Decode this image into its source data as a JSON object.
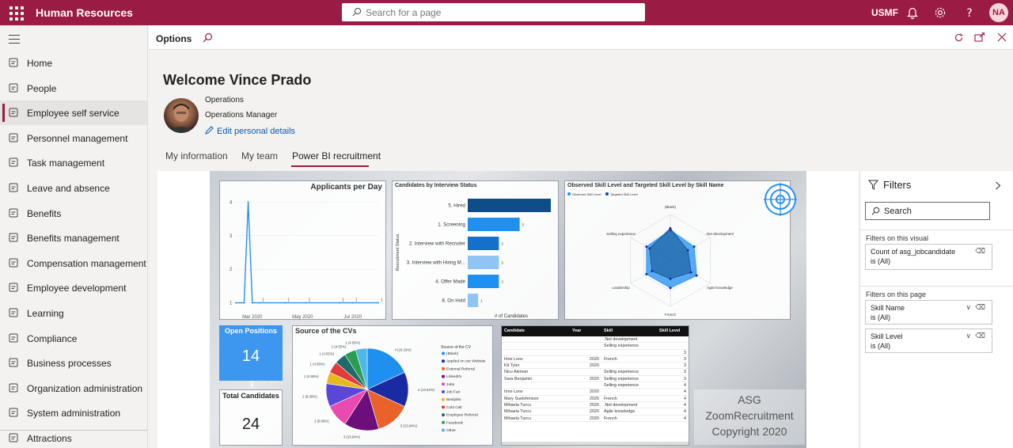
{
  "topbar": {
    "app_title": "Human Resources",
    "search_placeholder": "Search for a page",
    "company": "USMF",
    "user_initials": "NA"
  },
  "nav": {
    "items": [
      {
        "label": "Home",
        "icon": "home-icon"
      },
      {
        "label": "People",
        "icon": "people-icon"
      },
      {
        "label": "Employee self service",
        "icon": "self-service-icon",
        "active": true
      },
      {
        "label": "Personnel management",
        "icon": "personnel-icon"
      },
      {
        "label": "Task management",
        "icon": "task-icon"
      },
      {
        "label": "Leave and absence",
        "icon": "leave-icon"
      },
      {
        "label": "Benefits",
        "icon": "benefits-icon"
      },
      {
        "label": "Benefits management",
        "icon": "benefits-mgmt-icon"
      },
      {
        "label": "Compensation management",
        "icon": "compensation-icon"
      },
      {
        "label": "Employee development",
        "icon": "development-icon"
      },
      {
        "label": "Learning",
        "icon": "learning-icon"
      },
      {
        "label": "Compliance",
        "icon": "compliance-icon"
      },
      {
        "label": "Business processes",
        "icon": "process-icon"
      },
      {
        "label": "Organization administration",
        "icon": "org-icon"
      },
      {
        "label": "System administration",
        "icon": "system-icon"
      },
      {
        "label": "Attractions",
        "icon": "attractions-icon"
      }
    ]
  },
  "options_bar": {
    "label": "Options"
  },
  "profile": {
    "welcome": "Welcome Vince Prado",
    "department": "Operations",
    "title": "Operations Manager",
    "edit_link": "Edit personal details"
  },
  "tabs": [
    {
      "label": "My information"
    },
    {
      "label": "My team"
    },
    {
      "label": "Power BI recruitment",
      "active": true
    }
  ],
  "report": {
    "applicants": {
      "title": "Applicants per Day",
      "y_ticks": [
        "4",
        "3",
        "2",
        "1"
      ],
      "x_ticks": [
        "Mar 2020",
        "May 2020",
        "Jul 2020"
      ],
      "point_labels": [
        "1",
        "1",
        "1",
        "1",
        "1",
        "1"
      ]
    },
    "interview": {
      "title": "Candidates by Interview Status",
      "ylabel": "Recruitment Status",
      "xlabel": "# of Candidates"
    },
    "skill_radar": {
      "title": "Observed Skill Level and Targeted Skill Level by Skill Name",
      "legend": [
        "Observed Skill Level",
        "Targeted Skill Level"
      ],
      "axes": [
        "(Blank)",
        ".Net development",
        "Agile knowledge",
        "French",
        "Leadership",
        "Selling experience"
      ]
    },
    "open_positions": {
      "label": "Open Positions",
      "value": "14"
    },
    "total_candidates": {
      "label": "Total Candidates",
      "value": "24"
    },
    "source_cvs": {
      "title": "Source of the CVs",
      "legend_title": "Source of the CV",
      "legend": [
        "(Blank)",
        "Applied on our Website",
        "External Referral",
        "LinkedIN",
        "Jobs",
        "Job Fair",
        "Bestjobs",
        "Cold Call",
        "Employee Referral",
        "Facebook",
        "Other"
      ],
      "labels": [
        "4 (16.16%)",
        "3 (13.64%)",
        "3 (13.64%)",
        "3 (13.64%)",
        "2 (9.09%)",
        "2 (9.09%)",
        "1 (4.55%)",
        "1 (4.55%)",
        "1 (4.55%)",
        "1 (4.55%)",
        "1 (4.55%)"
      ]
    },
    "table": {
      "headers": [
        "Candidate",
        "Year",
        "Skill",
        "Skill Level"
      ],
      "rows": [
        [
          "",
          "",
          ".Net development",
          ""
        ],
        [
          "",
          "",
          "Selling experience",
          ""
        ],
        [
          "",
          "",
          "",
          "3"
        ],
        [
          "Irine Loox",
          "2020",
          "French",
          "3"
        ],
        [
          "Kit Tyler",
          "2020",
          "",
          "3"
        ],
        [
          "Nicu Aleman",
          "",
          "Selling experience",
          "3"
        ],
        [
          "Sara Benjamin",
          "2020",
          "Selling experience",
          "3"
        ],
        [
          "",
          "",
          "Selling experience",
          "4"
        ],
        [
          "Irine Loox",
          "2020",
          "",
          "4"
        ],
        [
          "Mary Suelohmson",
          "2020",
          "French",
          "4"
        ],
        [
          "Mihaela Turcu",
          "2020",
          ".Net development",
          "4"
        ],
        [
          "Mihaela Turcu",
          "2020",
          "Agile knowledge",
          "4"
        ],
        [
          "Mihaela Turcu",
          "2020",
          "French",
          "4"
        ]
      ]
    },
    "watermark": [
      "ASG",
      "ZoomRecruitment",
      "Copyright 2020"
    ]
  },
  "chart_data": [
    {
      "type": "line",
      "title": "Applicants per Day",
      "x": [
        "2020-02-10",
        "2020-02-20",
        "2020-02-25",
        "2020-03-01",
        "2020-03-10",
        "2020-04-10",
        "2020-05-05",
        "2020-06-15",
        "2020-07-01",
        "2020-08-01"
      ],
      "values": [
        1,
        1,
        4,
        1,
        1,
        1,
        1,
        1,
        1,
        1
      ],
      "ylim": [
        0.8,
        4.2
      ]
    },
    {
      "type": "bar",
      "orientation": "horizontal",
      "title": "Candidates by Interview Status",
      "categories": [
        "5. Hired",
        "1. Screening",
        "2. Interview with Recruiter",
        "3. Interview with Hiring M...",
        "4. Offer Made",
        "8. On Hold"
      ],
      "values": [
        8,
        5,
        3,
        3,
        3,
        1
      ],
      "colors": [
        "#0f4c8a",
        "#1f8ff0",
        "#1570cc",
        "#8fc4f5",
        "#1f8ff0",
        "#8fc4f5"
      ],
      "xlabel": "# of Candidates",
      "ylabel": "Recruitment Status"
    },
    {
      "type": "radar",
      "title": "Observed Skill Level and Targeted Skill Level by Skill Name",
      "axes": [
        "(Blank)",
        ".Net development",
        "Agile knowledge",
        "French",
        "Leadership",
        "Selling experience"
      ],
      "series": [
        {
          "name": "Observed Skill Level",
          "values": [
            3.3,
            3.0,
            3.3,
            3.0,
            3.0,
            3.0
          ],
          "color": "#1f8ff0"
        },
        {
          "name": "Targeted Skill Level",
          "values": [
            3.5,
            2.2,
            2.6,
            2.0,
            2.3,
            2.6
          ],
          "color": "#0f4c8a"
        }
      ],
      "max": 5
    },
    {
      "type": "pie",
      "title": "Source of the CVs",
      "categories": [
        "(Blank)",
        "Applied on our Website",
        "External Referral",
        "LinkedIN",
        "Jobs",
        "Job Fair",
        "Bestjobs",
        "Cold Call",
        "Employee Referral",
        "Facebook",
        "Other"
      ],
      "values": [
        4,
        3,
        3,
        3,
        2,
        2,
        1,
        1,
        1,
        1,
        1
      ],
      "colors": [
        "#1f8ff0",
        "#1a2aa3",
        "#e8622a",
        "#6c0f7a",
        "#e84ab0",
        "#5b47d6",
        "#e8b81f",
        "#e33b3b",
        "#1f6b6b",
        "#2a9d52",
        "#4fb8e8"
      ]
    }
  ],
  "filters": {
    "title": "Filters",
    "search_placeholder": "Search",
    "on_visual_label": "Filters on this visual",
    "on_page_label": "Filters on this page",
    "visual_filters": [
      {
        "name": "Count of asg_jobcandidate",
        "value": "is (All)"
      }
    ],
    "page_filters": [
      {
        "name": "Skill Name",
        "value": "is (All)"
      },
      {
        "name": "Skill Level",
        "value": "is (All)"
      }
    ]
  }
}
